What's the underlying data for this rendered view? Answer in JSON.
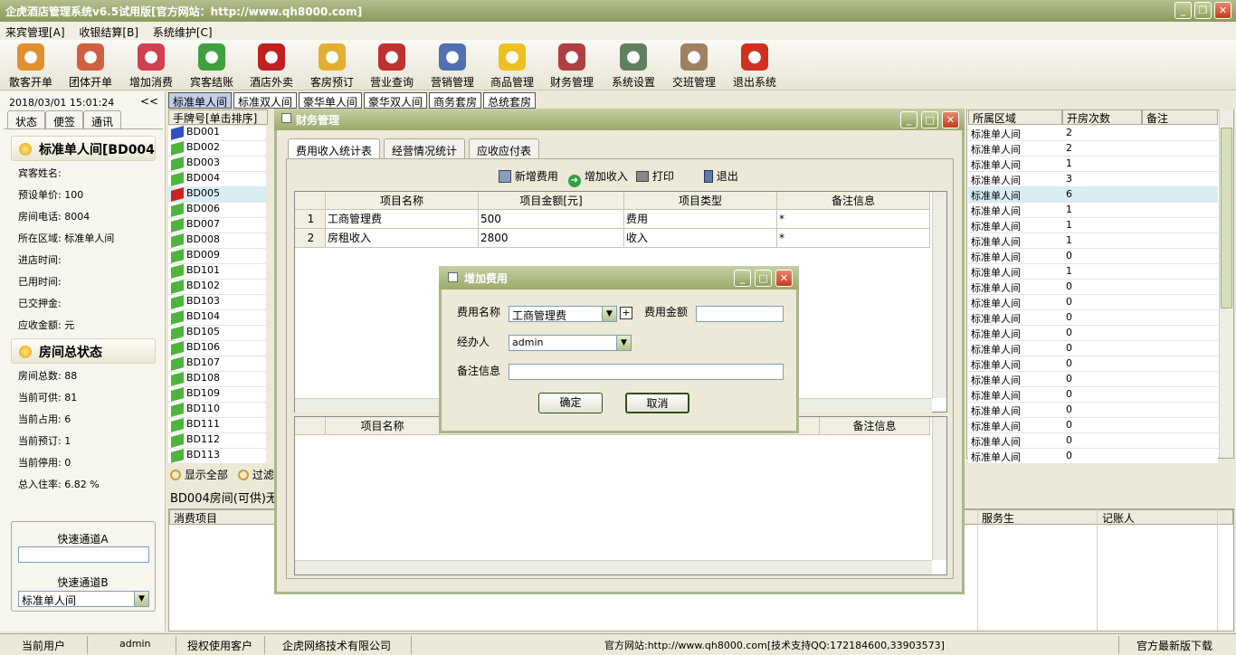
{
  "title": "企虎酒店管理系统v6.5试用版[官方网站：http://www.qh8000.com]",
  "menu": [
    "来宾管理[A]",
    "收银结算[B]",
    "系统维护[C]"
  ],
  "toolbar": [
    {
      "label": "散客开单",
      "icon": "guest-icon",
      "color": "#e09030"
    },
    {
      "label": "团体开单",
      "icon": "group-icon",
      "color": "#d06040"
    },
    {
      "label": "增加消费",
      "icon": "add-consume-icon",
      "color": "#d04050"
    },
    {
      "label": "宾客结账",
      "icon": "checkout-icon",
      "color": "#40a040"
    },
    {
      "label": "酒店外卖",
      "icon": "takeout-icon",
      "color": "#c02020"
    },
    {
      "label": "客房预订",
      "icon": "clock-icon",
      "color": "#e0b030"
    },
    {
      "label": "营业查询",
      "icon": "query-icon",
      "color": "#c03030"
    },
    {
      "label": "营销管理",
      "icon": "marketing-icon",
      "color": "#5070b0"
    },
    {
      "label": "商品管理",
      "icon": "star-icon",
      "color": "#f0c020"
    },
    {
      "label": "财务管理",
      "icon": "finance-icon",
      "color": "#b04040"
    },
    {
      "label": "系统设置",
      "icon": "settings-icon",
      "color": "#608060"
    },
    {
      "label": "交班管理",
      "icon": "handshake-icon",
      "color": "#a08060"
    },
    {
      "label": "退出系统",
      "icon": "power-icon",
      "color": "#d03020"
    }
  ],
  "left": {
    "datetime": "2018/03/01 15:01:24",
    "collapse": "<<",
    "tabs": [
      "状态",
      "便签",
      "通讯"
    ],
    "room_title": "标准单人间[BD004",
    "room_info": [
      "宾客姓名:",
      "预设单价: 100",
      "房间电话: 8004",
      "所在区域: 标准单人间",
      "进店时间:",
      "已用时间:",
      "已交押金:",
      "应收金额: 元"
    ],
    "summary_title": "房间总状态",
    "summary": [
      "房间总数: 88",
      "当前可供: 81",
      "当前占用: 6",
      "当前预订: 1",
      "当前停用: 0",
      "总入住率: 6.82 %"
    ],
    "quick_a": "快速通道A",
    "quick_b": "快速通道B",
    "quick_b_value": "标准单人间"
  },
  "room_tabs": [
    "标准单人间",
    "标准双人间",
    "豪华单人间",
    "豪华双人间",
    "商务套房",
    "总统套房"
  ],
  "grid": {
    "col_room": "手牌号[单击排序]",
    "col_area": "所属区域",
    "col_count": "开房次数",
    "col_note": "备注",
    "rooms": [
      "BD001",
      "BD002",
      "BD003",
      "BD004",
      "BD005",
      "BD006",
      "BD007",
      "BD008",
      "BD009",
      "BD101",
      "BD102",
      "BD103",
      "BD104",
      "BD105",
      "BD106",
      "BD107",
      "BD108",
      "BD109",
      "BD110",
      "BD111",
      "BD112",
      "BD113"
    ],
    "area": "标准单人间",
    "counts": [
      "2",
      "2",
      "1",
      "3",
      "6",
      "1",
      "1",
      "1",
      "0",
      "1",
      "0",
      "0",
      "0",
      "0",
      "0",
      "0",
      "0",
      "0",
      "0",
      "0",
      "0",
      "0"
    ]
  },
  "bottom": {
    "show_all": "显示全部",
    "filter": "过滤",
    "room_status": "BD004房间(可供)无",
    "col_item": "消费项目",
    "col_waiter": "服务生",
    "col_bookkeeper": "记账人"
  },
  "finance": {
    "title": "财务管理",
    "tabs": [
      "费用收入统计表",
      "经营情况统计",
      "应收应付表"
    ],
    "actions": [
      "新增费用",
      "增加收入",
      "打印",
      "退出"
    ],
    "headers": [
      "项目名称",
      "项目金额[元]",
      "项目类型",
      "备注信息"
    ],
    "rows": [
      {
        "no": "1",
        "name": "工商管理费",
        "amount": "500",
        "type": "费用",
        "note": "*"
      },
      {
        "no": "2",
        "name": "房租收入",
        "amount": "2800",
        "type": "收入",
        "note": "*"
      }
    ],
    "lower_headers": [
      "项目名称",
      "备注信息"
    ]
  },
  "dialog": {
    "title": "增加费用",
    "name_label": "费用名称",
    "name_value": "工商管理费",
    "plus": "+",
    "amount_label": "费用金额",
    "handler_label": "经办人",
    "handler_value": "admin",
    "note_label": "备注信息",
    "ok": "确定",
    "cancel": "取消"
  },
  "status": {
    "user_label": "当前用户",
    "user": "admin",
    "licensee_label": "授权使用客户",
    "licensee": "企虎网络技术有限公司",
    "website": "官方网站:http://www.qh8000.com[技术支持QQ:172184600,33903573]",
    "download": "官方最新版下载"
  }
}
